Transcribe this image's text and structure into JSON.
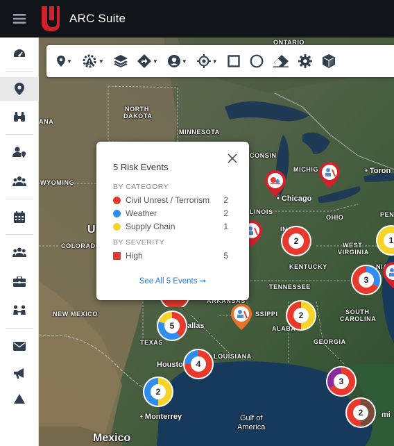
{
  "app": {
    "brand_name": "ARC Suite"
  },
  "sidebar": {
    "items": [
      {
        "name": "dashboard",
        "icon": "dashboard-icon"
      },
      {
        "name": "map",
        "icon": "map-pin-icon",
        "active": true
      },
      {
        "name": "monitor",
        "icon": "binoculars-icon"
      },
      {
        "name": "user-assign",
        "icon": "user-pin-icon"
      },
      {
        "name": "groups",
        "icon": "users-gear-icon"
      },
      {
        "name": "calendar",
        "icon": "calendar-icon"
      },
      {
        "name": "people",
        "icon": "people-icon"
      },
      {
        "name": "briefcase",
        "icon": "briefcase-icon"
      },
      {
        "name": "meeting",
        "icon": "meeting-icon"
      },
      {
        "name": "messages",
        "icon": "envelope-icon"
      },
      {
        "name": "alerts",
        "icon": "megaphone-icon"
      },
      {
        "name": "more",
        "icon": "triangle-icon"
      }
    ]
  },
  "toolbar": {
    "tools": [
      "location-pin-icon",
      "risk-alert-icon",
      "layers-icon",
      "directions-icon",
      "person-icon",
      "crosshair-icon",
      "square-draw-icon",
      "circle-draw-icon",
      "eraser-icon",
      "settings-icon",
      "cube-icon"
    ]
  },
  "map": {
    "labels": {
      "ontario": "ONTARIO",
      "north_dakota_1": "NORTH",
      "north_dakota_2": "DAKOTA",
      "minnesota": "MINNESOTA",
      "ana": "ANA",
      "wisconsin": "CONSIN",
      "michigan": "MICHIG",
      "toronto": "• Toron",
      "wyoming": "WYOMING",
      "chicago": "• Chicago",
      "illinois": "LINOIS",
      "indiana": "IN",
      "ohio": "OHIO",
      "penn": "PENI",
      "colorado": "COLORADO",
      "u_letter": "U",
      "west_virginia_1": "WEST",
      "west_virginia_2": "VIRGINIA",
      "kentucky": "KENTUCKY",
      "tennessee": "TENNESSEE",
      "arkansas": "ARKANSAS",
      "mississippi": "SSIPPI",
      "alabama": "ALABA",
      "south_carolina_1": "SOUTH",
      "south_carolina_2": "CAROLINA",
      "new_mexico": "NEW MEXICO",
      "texas": "TEXAS",
      "dallas": "allas",
      "louisiana": "LOUISIANA",
      "georgia": "GEORGIA",
      "houston": "Housto",
      "monterrey": "• Monterrey",
      "gulf_1": "Gulf of",
      "gulf_2": "America",
      "mexico": "Mexico",
      "miami": "mi",
      "nia": "NIA"
    },
    "clusters": [
      {
        "id": "cluster-dallas",
        "count": "5"
      },
      {
        "id": "cluster-houston",
        "count": "4"
      },
      {
        "id": "cluster-mexico-border",
        "count": "2"
      },
      {
        "id": "cluster-indiana",
        "count": "2"
      },
      {
        "id": "cluster-carolina",
        "count": "3"
      },
      {
        "id": "cluster-georgia",
        "count": "2"
      },
      {
        "id": "cluster-florida",
        "count": "3"
      },
      {
        "id": "cluster-miami",
        "count": "2"
      },
      {
        "id": "cluster-east",
        "count": "1"
      }
    ]
  },
  "popup": {
    "title": "5 Risk Events",
    "by_category_label": "BY CATEGORY",
    "categories": [
      {
        "label": "Civil Unrest / Terrorism",
        "count": "2",
        "color": "#e8392c"
      },
      {
        "label": "Weather",
        "count": "2",
        "color": "#2f8cf0"
      },
      {
        "label": "Supply Chain",
        "count": "1",
        "color": "#f5d327"
      }
    ],
    "by_severity_label": "BY SEVERITY",
    "severities": [
      {
        "label": "High",
        "count": "5",
        "color": "#e8392c"
      }
    ],
    "see_all_label": "See All 5 Events ➞"
  },
  "colors": {
    "red": "#e8392c",
    "blue": "#2f8cf0",
    "yellow": "#f5d327",
    "purple": "#8b2a9b",
    "brown": "#7a4a3a",
    "brand_red": "#d4202b",
    "link": "#2a7de1"
  }
}
